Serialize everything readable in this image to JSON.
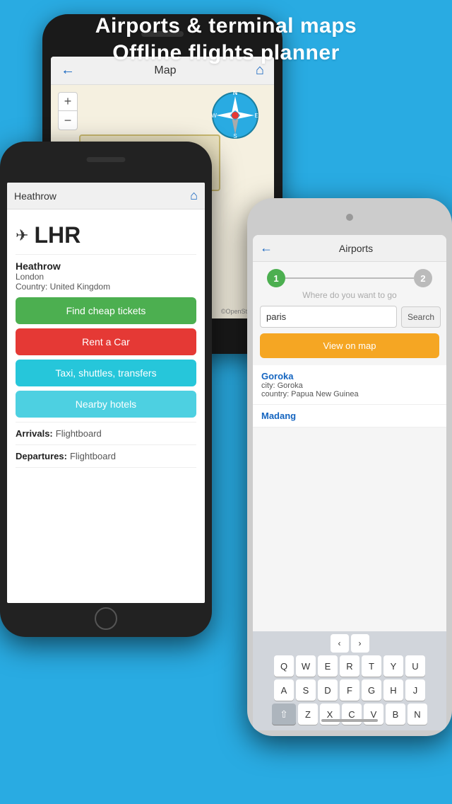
{
  "header": {
    "line1": "Airports & terminal maps",
    "line2": "Offline flights planner"
  },
  "back_phone": {
    "screen_title": "Map",
    "zoom_plus": "+",
    "zoom_minus": "−"
  },
  "left_phone": {
    "navbar_title": "Heathrow",
    "airport_code": "LHR",
    "airport_name": "Heathrow",
    "city": "London",
    "country_label": "Country: United Kingdom",
    "buttons": {
      "find_tickets": "Find cheap tickets",
      "rent_car": "Rent a Car",
      "taxi": "Taxi, shuttles, transfers",
      "hotels": "Nearby hotels"
    },
    "arrivals_label": "Arrivals:",
    "arrivals_value": "Flightboard",
    "departures_label": "Departures:",
    "departures_value": "Flightboard"
  },
  "right_phone": {
    "navbar_title": "Airports",
    "step1": "1",
    "step2": "2",
    "where_placeholder": "Where do you want to go",
    "search_input_value": "paris",
    "search_btn_label": "Search",
    "view_map_btn": "View on map",
    "result1": {
      "name": "Goroka",
      "city": "city: Goroka",
      "country": "country: Papua New Guinea"
    },
    "result2": {
      "name": "Madang"
    },
    "keyboard": {
      "row1": [
        "Q",
        "W",
        "E",
        "R",
        "T",
        "Y",
        "U"
      ],
      "row2": [
        "A",
        "S",
        "D",
        "F",
        "G",
        "H",
        "J"
      ],
      "row3": [
        "Z",
        "X",
        "C",
        "V",
        "B",
        "N"
      ],
      "arrows": [
        "<",
        ">"
      ]
    }
  }
}
